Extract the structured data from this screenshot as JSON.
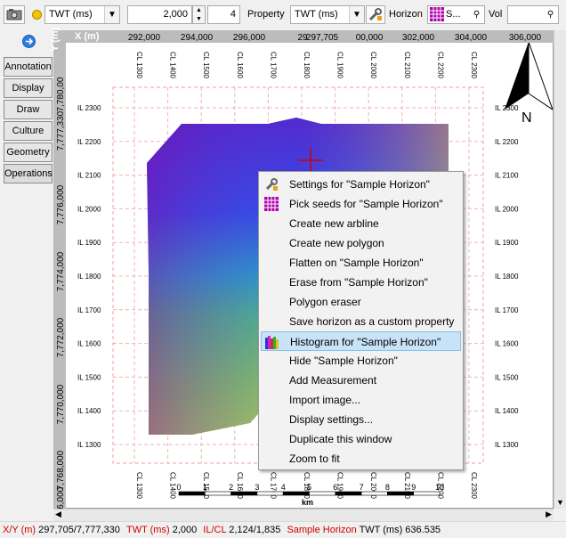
{
  "toolbar": {
    "domain_select": "TWT (ms)",
    "value_field": "2,000",
    "step_field": "4",
    "property_label": "Property",
    "property_select": "TWT (ms)",
    "horizon_label": "Horizon",
    "horizon_select": "S...",
    "vol_label": "Vol",
    "vol_select": ""
  },
  "side_tabs": [
    "Annotation",
    "Display",
    "Draw",
    "Culture",
    "Geometry",
    "Operations"
  ],
  "axes": {
    "x_title": "X (m)",
    "y_title": "Y (m)",
    "x_ticks": [
      "292,000",
      "294,000",
      "296,000",
      "29",
      "297,705",
      "00,000",
      "302,000",
      "304,000",
      "306,000"
    ],
    "y_ticks": [
      "7,780,00",
      "7,777,330",
      "7,776,000",
      "7,774,000",
      "7,772,000",
      "7,770,000",
      "7,768,000",
      "7,766,000"
    ],
    "cl_labels": [
      "CL 1300",
      "CL 1400",
      "CL 1500",
      "CL 1600",
      "CL 1700",
      "CL 1800",
      "CL 1900",
      "CL 2000",
      "CL 2100",
      "CL 2200",
      "CL 2300"
    ],
    "il_labels": [
      "IL 2300",
      "IL 2200",
      "IL 2100",
      "IL 2000",
      "IL 1900",
      "IL 1800",
      "IL 1700",
      "IL 1600",
      "IL 1500",
      "IL 1400",
      "IL 1300"
    ],
    "scale_ticks": [
      "0",
      "1",
      "2",
      "3",
      "4",
      "5",
      "6",
      "7",
      "8",
      "9",
      "10"
    ],
    "scale_unit": "km",
    "north_label": "N"
  },
  "context_menu": {
    "items": [
      {
        "label": "Settings for \"Sample Horizon\"",
        "icon": "wrench-icon"
      },
      {
        "label": "Pick seeds for \"Sample Horizon\"",
        "icon": "grid-icon"
      },
      {
        "label": "Create new arbline",
        "icon": ""
      },
      {
        "label": "Create new polygon",
        "icon": ""
      },
      {
        "label": "Flatten on \"Sample Horizon\"",
        "icon": ""
      },
      {
        "label": "Erase from \"Sample Horizon\"",
        "icon": ""
      },
      {
        "label": "Polygon eraser",
        "icon": ""
      },
      {
        "label": "Save horizon as a custom property",
        "icon": ""
      },
      {
        "label": "Histogram for \"Sample Horizon\"",
        "icon": "histogram-icon"
      },
      {
        "label": "Hide \"Sample Horizon\"",
        "icon": ""
      },
      {
        "label": "Add Measurement",
        "icon": ""
      },
      {
        "label": "Import image...",
        "icon": ""
      },
      {
        "label": "Display settings...",
        "icon": ""
      },
      {
        "label": "Duplicate this window",
        "icon": ""
      },
      {
        "label": "Zoom to fit",
        "icon": ""
      }
    ],
    "highlighted_index": 8
  },
  "status_bar": {
    "xy_label": "X/Y (m)",
    "xy_value": "297,705/7,777,330",
    "twt_label": "TWT (ms)",
    "twt_value": "2,000",
    "ilcl_label": "IL/CL",
    "ilcl_value": "2,124/1,835",
    "horizon_label": "Sample Horizon",
    "horizon_value": "TWT (ms) 636.535"
  },
  "colors": {
    "accent_red": "#d00000",
    "menu_highlight": "#c8e3f8"
  }
}
